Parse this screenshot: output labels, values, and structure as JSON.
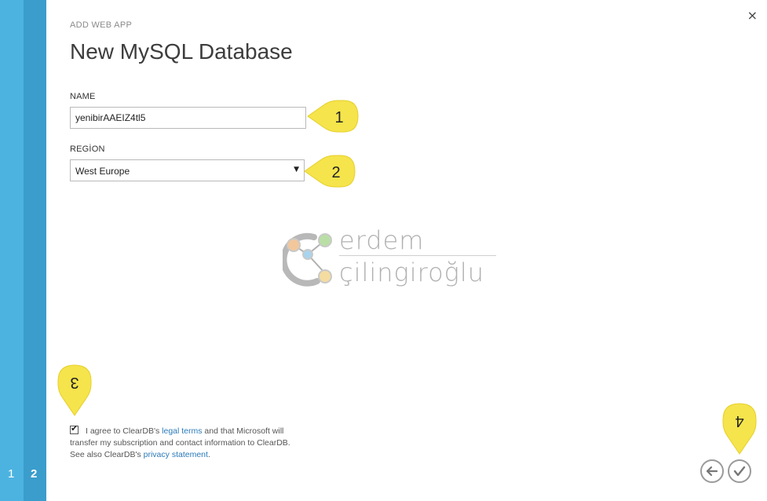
{
  "wizard": {
    "steps": [
      "1",
      "2"
    ],
    "active_step": "2"
  },
  "header": {
    "pre_title": "ADD WEB APP",
    "title": "New MySQL Database",
    "close_label": "×"
  },
  "form": {
    "name_label": "NAME",
    "name_value": "yenibirAAEIZ4tl5",
    "region_label": "REGİON",
    "region_value": "West Europe"
  },
  "callouts": [
    "1",
    "2",
    "3",
    "4"
  ],
  "watermark": {
    "line1": "erdem",
    "line2": "çilingiroğlu"
  },
  "agreement": {
    "checked": true,
    "text_part1": "I agree to ClearDB's ",
    "legal_link": "legal terms",
    "text_part2": " and that Microsoft will transfer my subscription and contact information to ClearDB. See also ClearDB's ",
    "privacy_link": "privacy statement",
    "text_part3": "."
  },
  "icons": {
    "back": "arrow-left-icon",
    "ok": "check-icon"
  },
  "colors": {
    "rail": "#4cb3e1",
    "rail_active": "#3a9dcc",
    "callout": "#f5e44b",
    "link": "#2a7ab8"
  }
}
